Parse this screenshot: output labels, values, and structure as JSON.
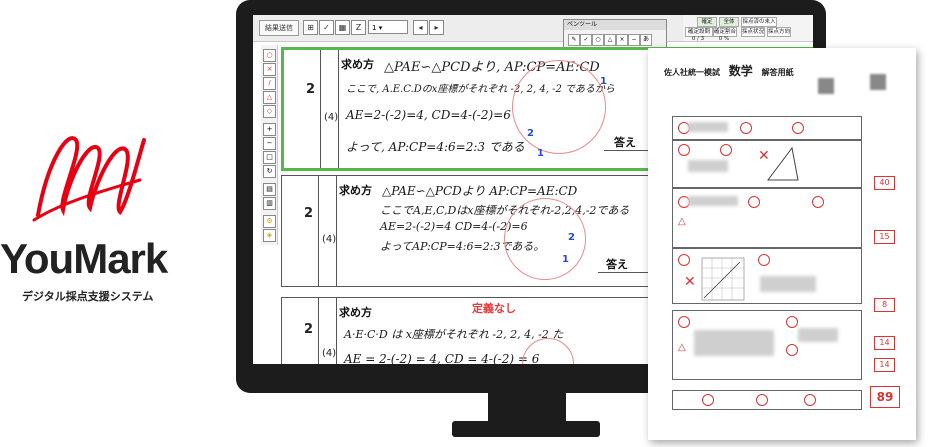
{
  "brand": {
    "name": "YouMark",
    "tagline": "デジタル採点支援システム",
    "color": "#e60012"
  },
  "toolbar": {
    "result_button": "結果送信",
    "page_select": "1"
  },
  "palette": {
    "title": "ペンツール"
  },
  "info": {
    "labels": [
      "確定",
      "全体",
      "採点済の未入",
      "確定設問",
      "確定割合",
      "採点状況",
      "採点方向"
    ],
    "values": [
      "0 / 3",
      "0 %"
    ]
  },
  "panels": [
    {
      "question_number": "2",
      "sub_number": "(4)",
      "label": "求め方",
      "lines": [
        "△PAE∽△PCDより, AP:CP=AE:CD",
        "ここで, A.E.C.Dのx座標がそれぞれ -2, 2, 4, -2 であるから",
        "AE=2-(-2)=4, CD=4-(-2)=6",
        "よって, AP:CP=4:6=2:3 である"
      ],
      "answer_label": "答え",
      "selected": true
    },
    {
      "question_number": "2",
      "sub_number": "(4)",
      "label": "求め方",
      "lines": [
        "△PAE∽△PCDより AP:CP=AE:CD",
        "ここでA,E,C,Dはx座標がそれぞれ-2,2,4,-2である",
        "AE=2-(-2)=4  CD=4-(-2)=6",
        "よってAP:CP=4:6=2:3である。"
      ],
      "answer_label": "答え",
      "selected": false
    },
    {
      "question_number": "2",
      "sub_number": "(4)",
      "label": "求め方",
      "note": "定義なし",
      "lines": [
        "A·E·C·D は x座標がそれぞれ -2, 2, 4, -2 た",
        "AE = 2-(-2) = 4, CD = 4-(-2) = 6"
      ],
      "selected": false
    }
  ],
  "sheet": {
    "header": "佐人社統一模試",
    "subject": "数学",
    "type": "解答用紙",
    "scores": [
      "40",
      "15",
      "8",
      "14",
      "14"
    ],
    "total": "89"
  }
}
